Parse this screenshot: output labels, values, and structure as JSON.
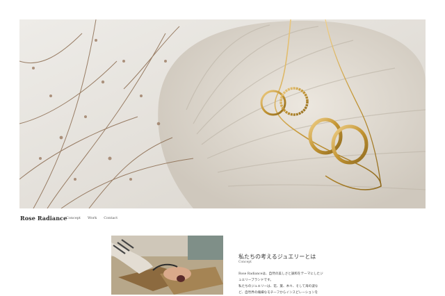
{
  "brand": {
    "name": "Rose Radiance"
  },
  "nav": {
    "items": [
      "Concept",
      "Work",
      "Contact"
    ]
  },
  "hero": {
    "alt_icon": "jewelry-hero-image"
  },
  "concept": {
    "title": "私たちの考えるジュエリーとは",
    "subtitle": "Concept",
    "body": [
      "Rose Radianceは、自然の美しさと調和をテーマにしたジ",
      "ュエリーブランドです。",
      "私たちのジュエリーは、花、葉、木々、そして海の波な",
      "ど、自然界の繊細なモチーフからインスピレーションを"
    ]
  },
  "colors": {
    "accent": "#c9a14a",
    "background": "#ffffff",
    "text": "#2a2a2a"
  }
}
